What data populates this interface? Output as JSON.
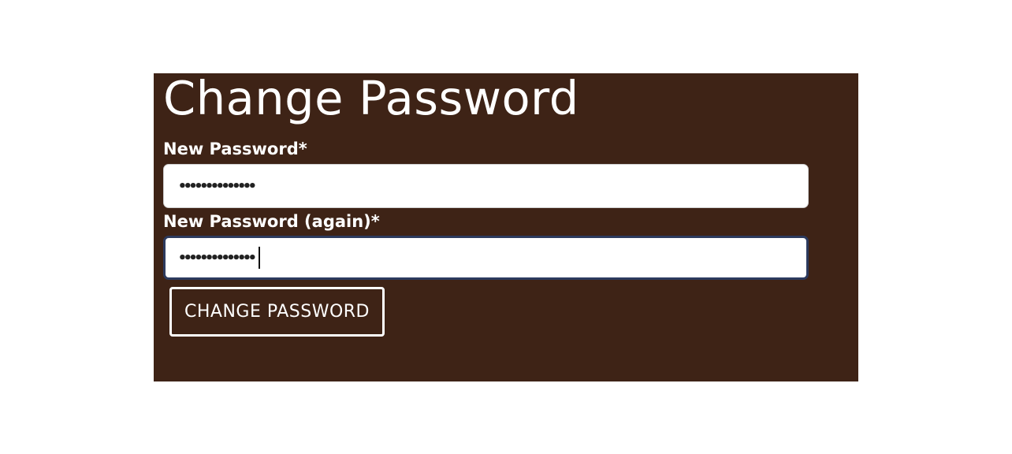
{
  "page": {
    "title": "Change Password"
  },
  "form": {
    "new_password": {
      "label": "New Password*",
      "value_masked": "••••••••••••••"
    },
    "new_password_again": {
      "label": "New Password (again)*",
      "value_masked": "••••••••••••••",
      "focused": true
    },
    "submit_label": "CHANGE PASSWORD"
  },
  "colors": {
    "panel_background": "#3e2316",
    "text": "#ffffff",
    "focus_ring": "#2c3a5e"
  }
}
